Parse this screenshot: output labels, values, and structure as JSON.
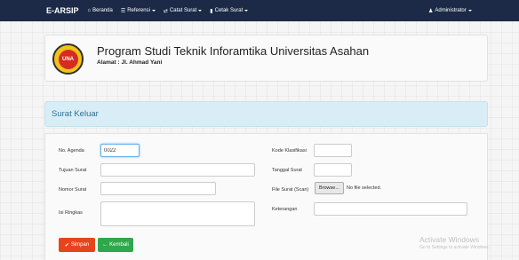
{
  "navbar": {
    "brand": "E-ARSIP",
    "items": [
      {
        "icon": "home-icon",
        "glyph": "⌂",
        "label": "Beranda",
        "dropdown": false
      },
      {
        "icon": "list-icon",
        "glyph": "☰",
        "label": "Referensi",
        "dropdown": true
      },
      {
        "icon": "shuffle-icon",
        "glyph": "⇄",
        "label": "Catat Surat",
        "dropdown": true
      },
      {
        "icon": "file-icon",
        "glyph": "▮",
        "label": "Cetak Surat",
        "dropdown": true
      }
    ],
    "user": {
      "icon": "user-icon",
      "glyph": "♟",
      "label": "Administrator"
    }
  },
  "header": {
    "title": "Program Studi Teknik Inforamtika Universitas Asahan",
    "address": "Alamat : Jl. Ahmad Yani",
    "logo_text": "UNA"
  },
  "section": {
    "title": "Surat Keluar"
  },
  "form": {
    "no_agenda": {
      "label": "No. Agenda",
      "value": "0022"
    },
    "tujuan_surat": {
      "label": "Tujuan Surat",
      "value": ""
    },
    "nomor_surat": {
      "label": "Nomor Surat",
      "value": ""
    },
    "isi_ringkas": {
      "label": "Isi Ringkas",
      "value": ""
    },
    "kode_klasifikasi": {
      "label": "Kode Klasifikasi",
      "value": ""
    },
    "tanggal_surat": {
      "label": "Tanggal Surat",
      "value": ""
    },
    "file_surat": {
      "label": "File Surat (Scan)",
      "button": "Browse...",
      "status": "No file selected."
    },
    "keterangan": {
      "label": "Keterangan",
      "value": ""
    }
  },
  "buttons": {
    "save": {
      "icon": "check-icon",
      "glyph": "✔",
      "label": "Simpan"
    },
    "back": {
      "icon": "arrow-left-icon",
      "glyph": "←",
      "label": "Kembali"
    }
  },
  "watermark": {
    "title": "Activate Windows",
    "subtitle": "Go to Settings to activate Windows."
  },
  "colors": {
    "navbar": "#1c2a48",
    "section_head": "#d9edf7",
    "section_text": "#31708f",
    "danger": "#e8441c",
    "success": "#2ea84a"
  }
}
